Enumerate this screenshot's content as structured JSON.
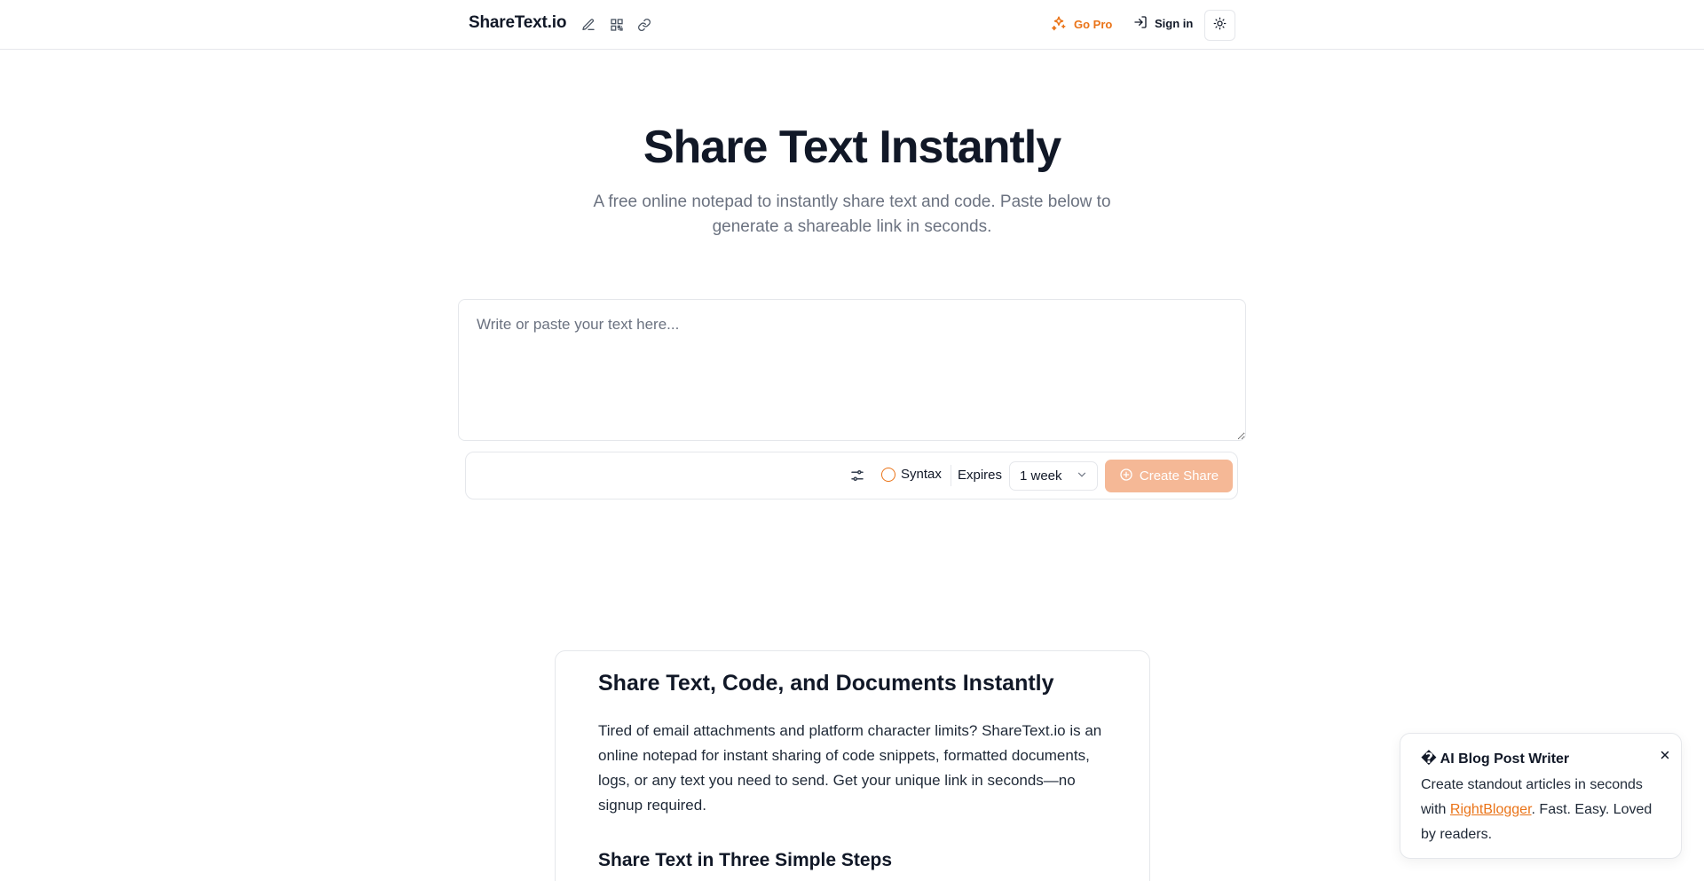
{
  "header": {
    "brand": "ShareText.io",
    "icons": [
      "pencil-icon",
      "qr-code-icon",
      "link-icon"
    ],
    "go_pro_label": "Go Pro",
    "sign_in_label": "Sign in",
    "theme_icon": "sun-icon",
    "accent_color": "#ea7317"
  },
  "hero": {
    "title": "Share Text Instantly",
    "subtitle": "A free online notepad to instantly share text and code. Paste below to generate a shareable link in seconds."
  },
  "editor": {
    "placeholder": "Write or paste your text here...",
    "value": ""
  },
  "toolbar": {
    "settings_icon": "sliders-icon",
    "syntax_label": "Syntax",
    "expires_label": "Expires",
    "expires_value": "1 week",
    "create_label": "Create Share",
    "create_icon": "plus-circle-icon",
    "create_color": "#f5b896"
  },
  "content": {
    "title": "Share Text, Code, and Documents Instantly",
    "body": "Tired of email attachments and platform character limits? ShareText.io is an online notepad for instant sharing of code snippets, formatted documents, logs, or any text you need to send. Get your unique link in seconds—no signup required.",
    "subheading": "Share Text in Three Simple Steps"
  },
  "toast": {
    "title": "� AI Blog Post Writer",
    "body_before": "Create standout articles in seconds with ",
    "link_text": "RightBlogger",
    "body_after": ". Fast. Easy. Loved by readers.",
    "close_icon": "close-icon"
  }
}
